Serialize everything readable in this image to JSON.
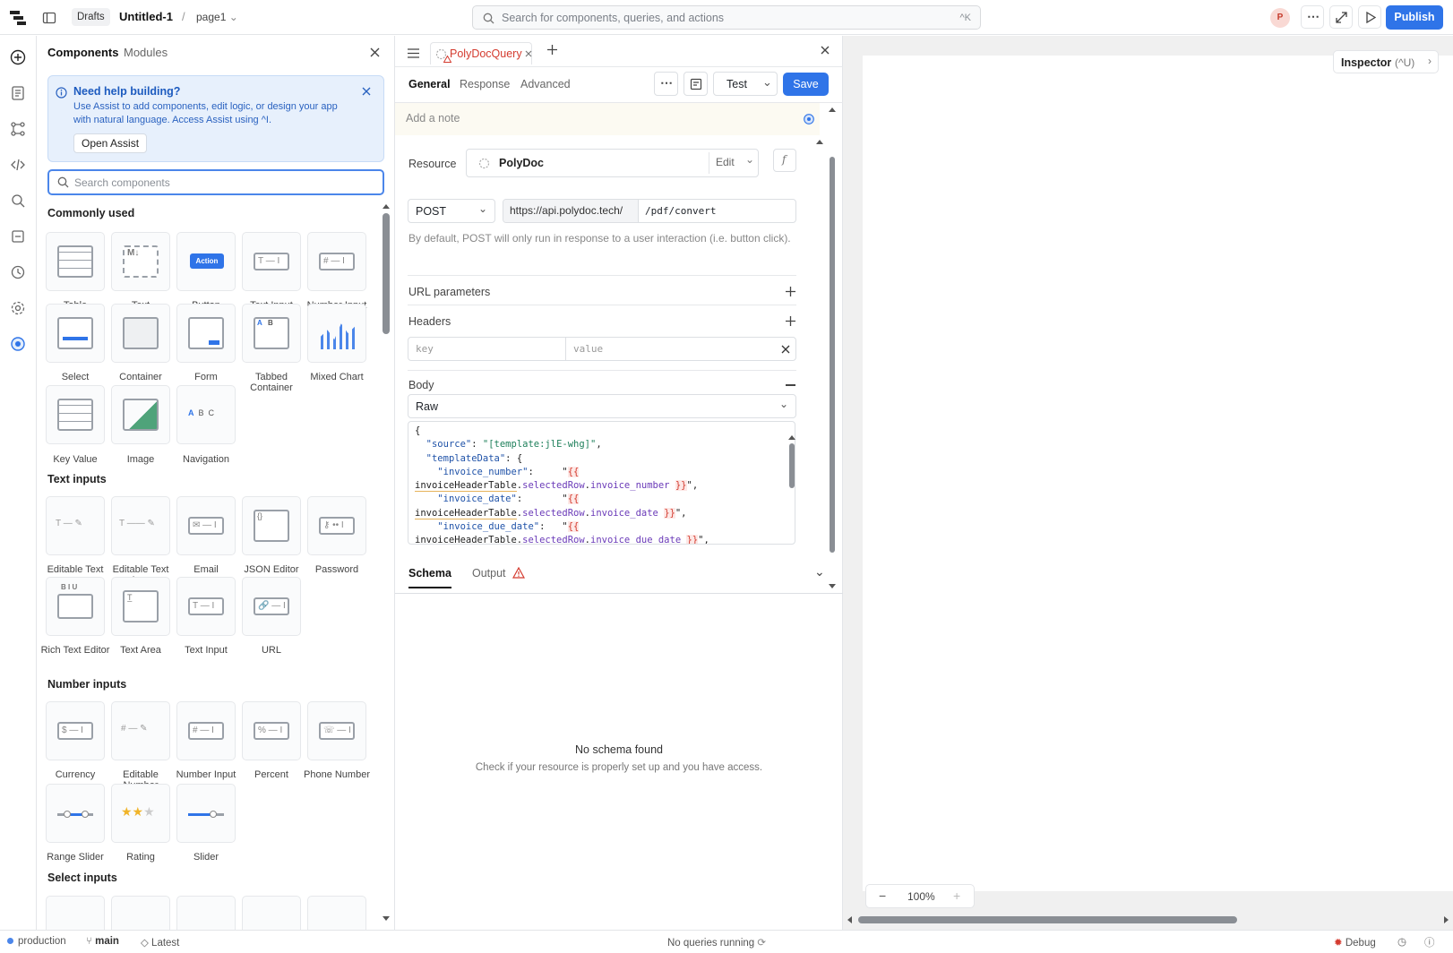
{
  "topbar": {
    "drafts": "Drafts",
    "app_title": "Untitled-1",
    "separator": "/",
    "page": "page1",
    "search_placeholder": "Search for components, queries, and actions",
    "search_shortcut": "^K",
    "avatar": "P",
    "publish": "Publish"
  },
  "components_panel": {
    "tabs": [
      "Components",
      "Modules"
    ],
    "help": {
      "title": "Need help building?",
      "desc": "Use Assist to add components, edit logic, or design your app with natural language. Access Assist using ^I.",
      "button": "Open Assist"
    },
    "search_placeholder": "Search components",
    "sections": [
      {
        "title": "Commonly used",
        "items": [
          "Table",
          "Text",
          "Button",
          "Text Input",
          "Number Input",
          "Select",
          "Container",
          "Form",
          "Tabbed Container",
          "Mixed Chart",
          "Key Value",
          "Image",
          "Navigation"
        ]
      },
      {
        "title": "Text inputs",
        "items": [
          "Editable Text",
          "Editable Text Area",
          "Email",
          "JSON Editor",
          "Password",
          "Rich Text Editor",
          "Text Area",
          "Text Input",
          "URL"
        ]
      },
      {
        "title": "Number inputs",
        "items": [
          "Currency",
          "Editable Number",
          "Number Input",
          "Percent",
          "Phone Number",
          "Range Slider",
          "Rating",
          "Slider"
        ]
      },
      {
        "title": "Select inputs",
        "items": []
      }
    ],
    "button_tile_text": "Action"
  },
  "query_editor": {
    "query_name": "PolyDocQuery",
    "tabs": [
      "General",
      "Response",
      "Advanced"
    ],
    "test": "Test",
    "save": "Save",
    "note_placeholder": "Add a note",
    "resource_label": "Resource",
    "resource_name": "PolyDoc",
    "edit": "Edit",
    "method": "POST",
    "base_url": "https://api.polydoc.tech/",
    "path": "/pdf/convert",
    "post_hint": "By default, POST will only run in response to a user interaction (i.e. button click).",
    "url_params": "URL parameters",
    "headers": "Headers",
    "key_placeholder": "key",
    "value_placeholder": "value",
    "body": "Body",
    "body_type": "Raw",
    "bottom_tabs": [
      "Schema",
      "Output"
    ],
    "no_schema_title": "No schema found",
    "no_schema_desc": "Check if your resource is properly set up and you have access."
  },
  "canvas": {
    "inspector": "Inspector",
    "inspector_shortcut": "(^U)",
    "zoom": "100%"
  },
  "status": {
    "env": "production",
    "branch": "main",
    "version": "Latest",
    "queries": "No queries running",
    "debug": "Debug"
  }
}
